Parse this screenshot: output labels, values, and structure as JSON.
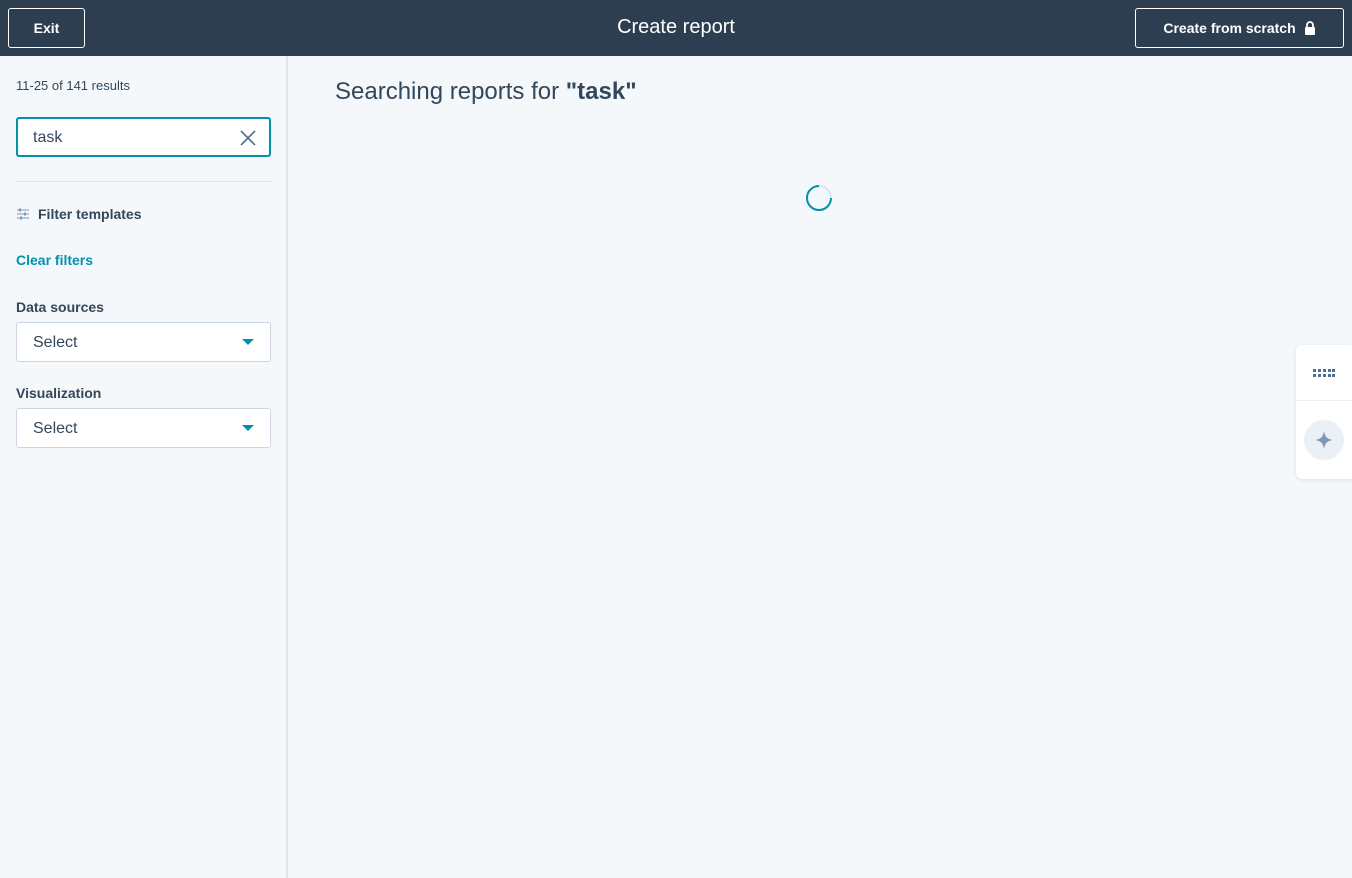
{
  "header": {
    "exit_label": "Exit",
    "title": "Create report",
    "create_scratch_label": "Create from scratch"
  },
  "sidebar": {
    "results_count": "11-25 of 141 results",
    "search": {
      "value": "task"
    },
    "filter_heading": "Filter templates",
    "clear_filters_label": "Clear filters",
    "data_sources": {
      "label": "Data sources",
      "value": "Select"
    },
    "visualization": {
      "label": "Visualization",
      "value": "Select"
    }
  },
  "main": {
    "heading_prefix": "Searching reports for ",
    "heading_query": "\"task\""
  },
  "side_panel": {
    "icons": [
      "grid-dots-icon",
      "sparkle-icon"
    ]
  },
  "colors": {
    "header_bg": "#2d3e50",
    "accent": "#0091ae",
    "page_bg": "#f5f8fa",
    "text": "#33475b"
  }
}
